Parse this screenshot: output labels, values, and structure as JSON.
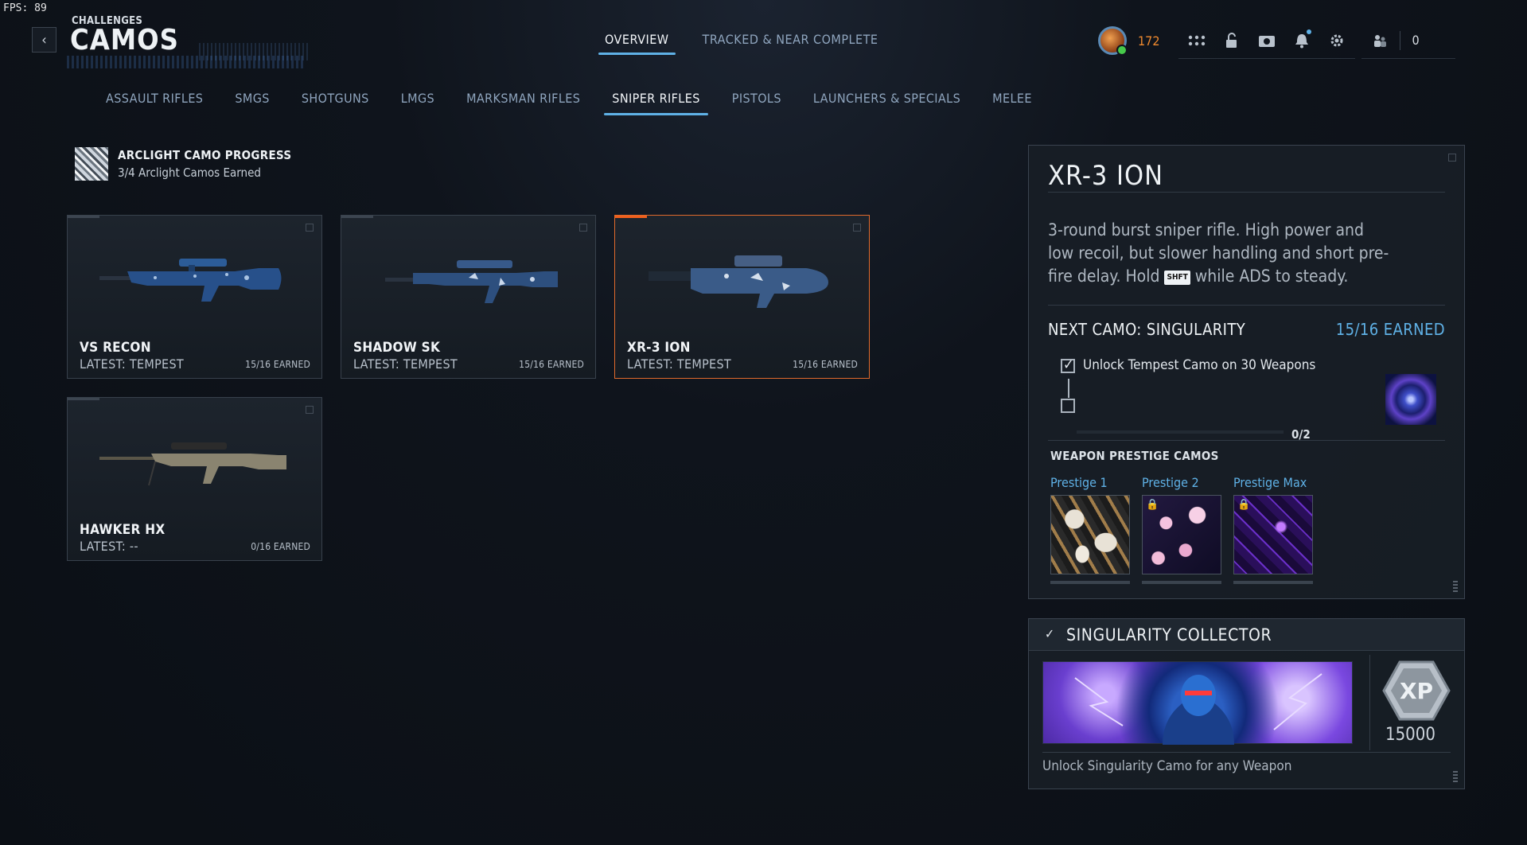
{
  "fps": "FPS:  89",
  "header": {
    "breadcrumb": "CHALLENGES",
    "title": "CAMOS",
    "tabs": [
      {
        "label": "OVERVIEW",
        "active": true
      },
      {
        "label": "TRACKED & NEAR COMPLETE",
        "active": false
      }
    ]
  },
  "player": {
    "level": "172",
    "party_count": "0",
    "icons": [
      "grid-icon",
      "lock-icon",
      "camera-icon",
      "bell-icon",
      "gear-icon",
      "party-icon"
    ]
  },
  "categories": [
    {
      "label": "ASSAULT RIFLES",
      "active": false
    },
    {
      "label": "SMGS",
      "active": false
    },
    {
      "label": "SHOTGUNS",
      "active": false
    },
    {
      "label": "LMGS",
      "active": false
    },
    {
      "label": "MARKSMAN RIFLES",
      "active": false
    },
    {
      "label": "SNIPER RIFLES",
      "active": true
    },
    {
      "label": "PISTOLS",
      "active": false
    },
    {
      "label": "LAUNCHERS & SPECIALS",
      "active": false
    },
    {
      "label": "MELEE",
      "active": false
    }
  ],
  "arclight": {
    "title": "ARCLIGHT CAMO PROGRESS",
    "subtitle": "3/4 Arclight Camos Earned"
  },
  "weapons": [
    {
      "name": "VS RECON",
      "latest": "LATEST: TEMPEST",
      "earned": "15/16 EARNED",
      "selected": false
    },
    {
      "name": "SHADOW SK",
      "latest": "LATEST: TEMPEST",
      "earned": "15/16 EARNED",
      "selected": false
    },
    {
      "name": "XR-3 ION",
      "latest": "LATEST: TEMPEST",
      "earned": "15/16 EARNED",
      "selected": true
    },
    {
      "name": "HAWKER HX",
      "latest": "LATEST: --",
      "earned": "0/16 EARNED",
      "selected": false
    }
  ],
  "detail": {
    "name": "XR-3 ION",
    "desc_part1": "3-round burst sniper rifle. High power and low recoil, but slower handling and short pre-fire delay. Hold ",
    "key": "SHFT",
    "desc_part2": " while ADS to steady.",
    "next_camo_label": "NEXT CAMO: SINGULARITY",
    "next_camo_earned": "15/16 EARNED",
    "requirements": [
      {
        "text": "Unlock Tempest Camo on 30 Weapons",
        "checked": true
      },
      {
        "text": "",
        "checked": false
      }
    ],
    "progress_text": "0/2",
    "progress_fraction": 0,
    "prestige_title": "WEAPON PRESTIGE CAMOS",
    "prestige": [
      {
        "label": "Prestige 1",
        "locked": false
      },
      {
        "label": "Prestige 2",
        "locked": true
      },
      {
        "label": "Prestige Max",
        "locked": true
      }
    ]
  },
  "collector": {
    "title": "SINGULARITY COLLECTOR",
    "xp_label": "XP",
    "xp_amount": "15000",
    "description": "Unlock Singularity Camo for any Weapon"
  },
  "colors": {
    "accent_blue": "#5fb1e6",
    "selected_orange": "#e06a2c",
    "level_orange": "#f08a2f"
  }
}
